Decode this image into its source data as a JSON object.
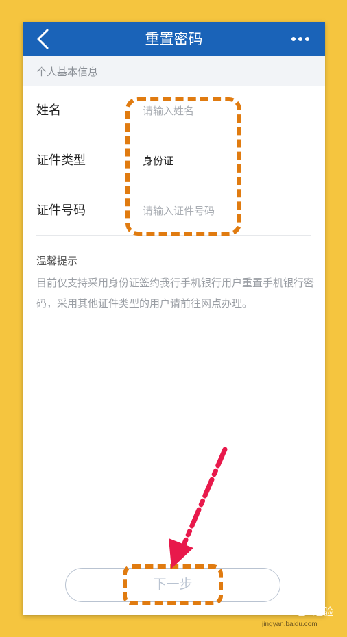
{
  "nav": {
    "title": "重置密码",
    "back_icon": "chevron-left-icon",
    "more_icon": "more-horizontal-icon"
  },
  "section": {
    "title": "个人基本信息"
  },
  "form": {
    "name": {
      "label": "姓名",
      "placeholder": "请输入姓名",
      "value": ""
    },
    "id_type": {
      "label": "证件类型",
      "value": "身份证"
    },
    "id_number": {
      "label": "证件号码",
      "placeholder": "请输入证件号码",
      "value": ""
    }
  },
  "tips": {
    "title": "温馨提示",
    "body": "目前仅支持采用身份证签约我行手机银行用户重置手机银行密码，采用其他证件类型的用户请前往网点办理。"
  },
  "footer": {
    "next_label": "下一步"
  },
  "colors": {
    "nav_bg": "#1a63b8",
    "page_bg": "#f5c53f",
    "highlight": "#e07b10",
    "arrow": "#e8194b",
    "button_border": "#b9c3d1"
  },
  "watermark": {
    "brand": "Bai",
    "text": "经验",
    "url": "jingyan.baidu.com"
  }
}
